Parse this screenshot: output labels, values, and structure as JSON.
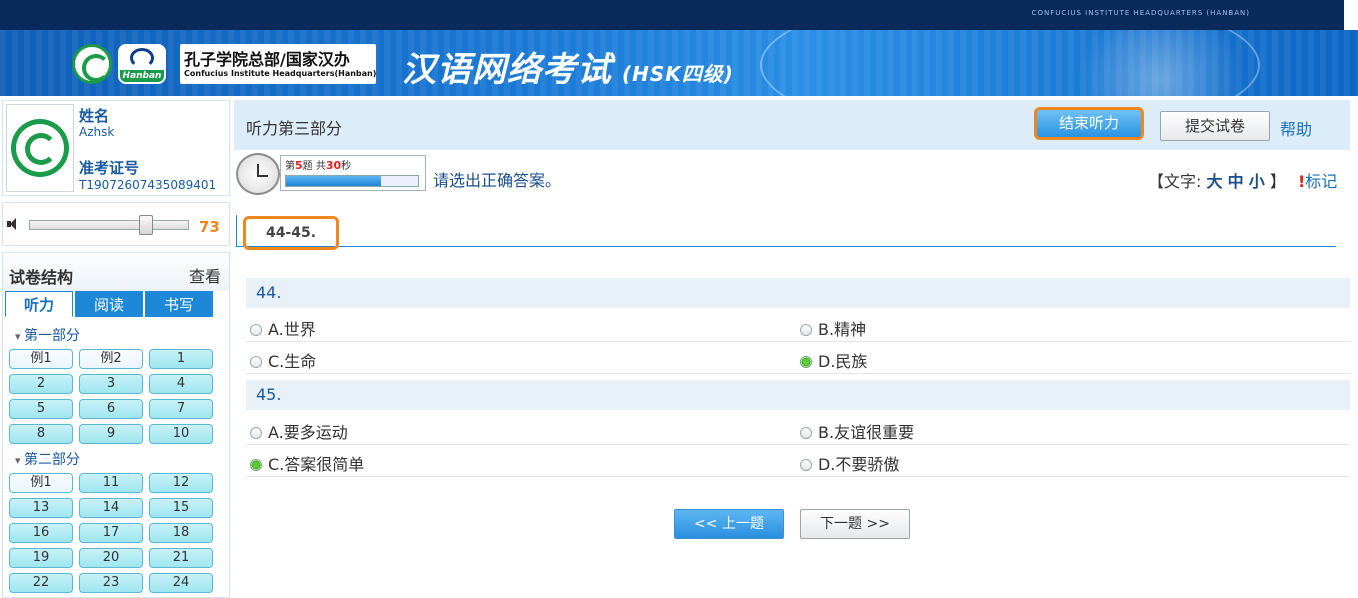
{
  "header": {
    "top_en": "CONFUCIUS INSTITUTE HEADQUARTERS (HANBAN)",
    "hanban_logo_text": "Hanban",
    "org_cn": "孔子学院总部/国家汉办",
    "org_en": "Confucius Institute Headquarters(Hanban)",
    "title": "汉语网络考试",
    "title_sub": "(HSK四级)"
  },
  "user": {
    "name_label": "姓名",
    "name_value": "Azhsk",
    "id_label": "准考证号",
    "id_value": "T19072607435089401"
  },
  "volume": {
    "value": "73",
    "level": 0.73
  },
  "structure": {
    "title": "试卷结构",
    "view": "查看",
    "tabs": [
      "听力",
      "阅读",
      "书写"
    ],
    "part1_label": "第一部分",
    "part1_buttons": [
      "例1",
      "例2",
      "1",
      "2",
      "3",
      "4",
      "5",
      "6",
      "7",
      "8",
      "9",
      "10"
    ],
    "part2_label": "第二部分",
    "part2_buttons": [
      "例1",
      "11",
      "12",
      "13",
      "14",
      "15",
      "16",
      "17",
      "18",
      "19",
      "20",
      "21",
      "22",
      "23",
      "24"
    ]
  },
  "section": {
    "title": "听力第三部分",
    "end_listening": "结束听力",
    "submit": "提交试卷",
    "help": "帮助"
  },
  "timer": {
    "prefix": "第",
    "question": "5",
    "mid": "题  共",
    "seconds": "30",
    "suffix": "秒",
    "progress": 0.72
  },
  "instruction": "请选出正确答案。",
  "fontsize": {
    "open": "【文字:",
    "large": "大",
    "medium": "中",
    "small": "小",
    "close": "】"
  },
  "mark": {
    "bang": "!",
    "label": "标记"
  },
  "question_range": "44-45.",
  "questions": [
    {
      "number": "44.",
      "options": [
        "A.世界",
        "B.精神",
        "C.生命",
        "D.民族"
      ],
      "selected": 3
    },
    {
      "number": "45.",
      "options": [
        "A.要多运动",
        "B.友谊很重要",
        "C.答案很简单",
        "D.不要骄傲"
      ],
      "selected": 2
    }
  ],
  "nav": {
    "prev": "<< 上一题",
    "next": "下一题 >>"
  },
  "colors": {
    "accent": "#1e88d8",
    "highlight": "#f0861e",
    "selected": "#4cb22a"
  }
}
